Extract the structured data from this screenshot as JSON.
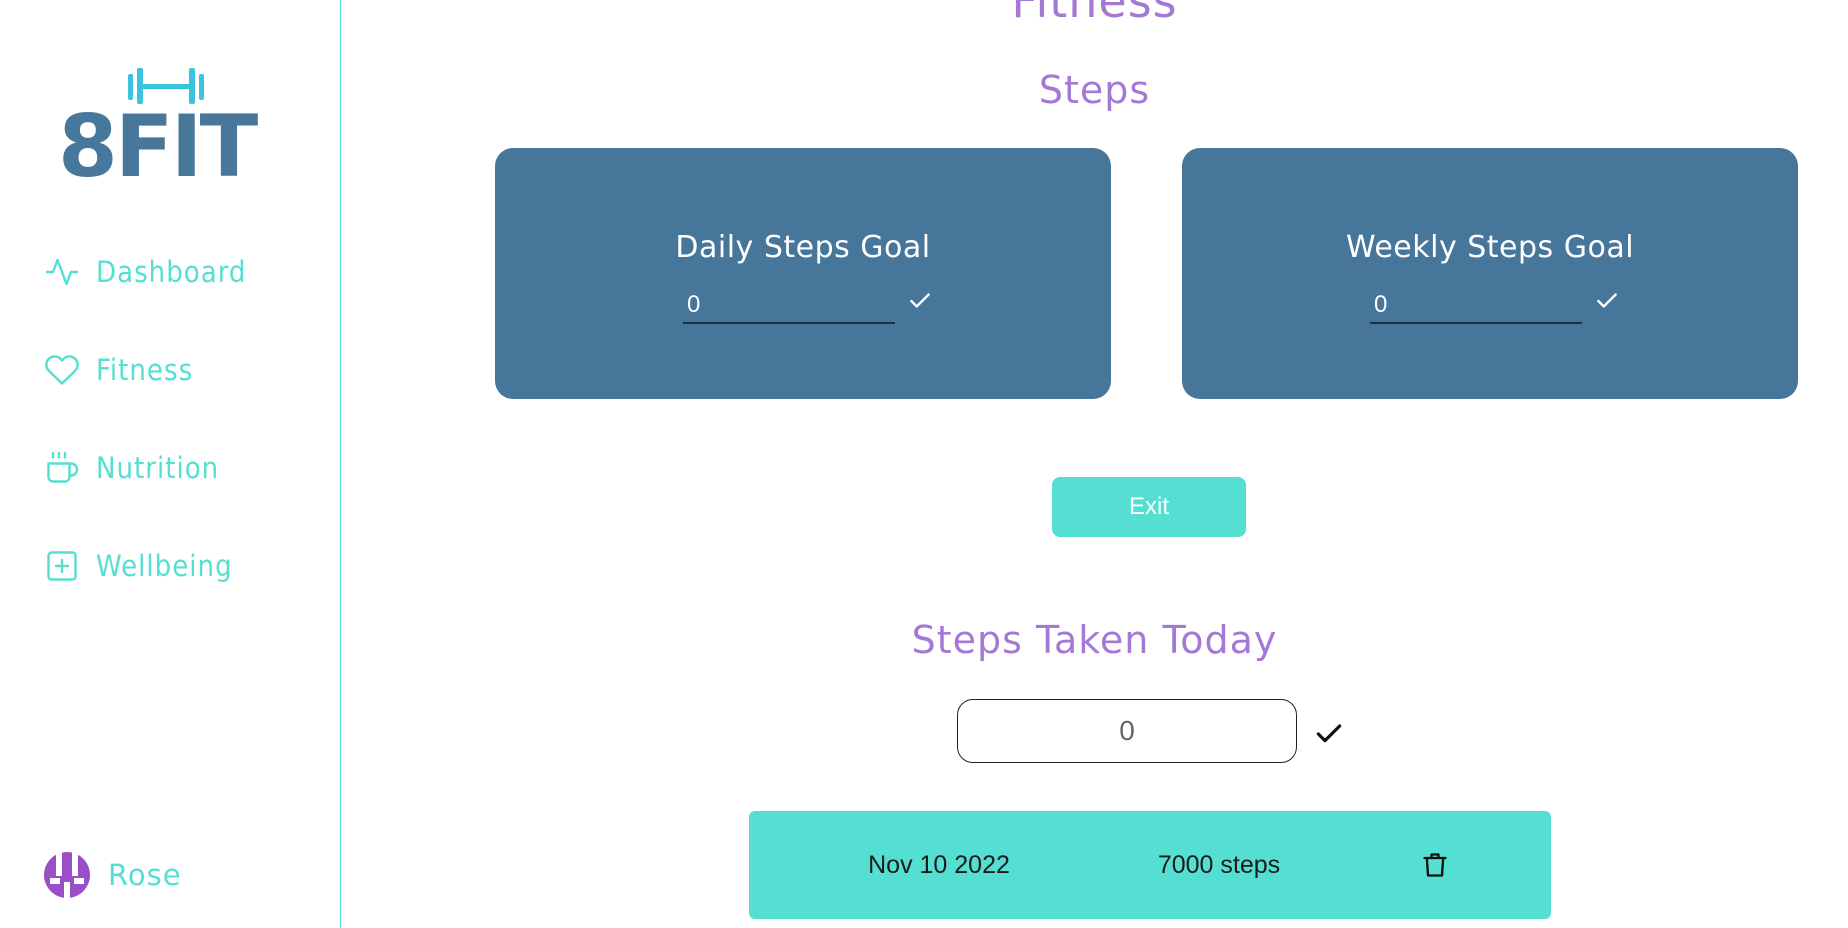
{
  "brand": {
    "logo_text": "8FIT",
    "logo_color": "#47779b",
    "accent_color": "#55dfd2",
    "heading_color": "#a479d6",
    "card_color": "#47769b"
  },
  "sidebar": {
    "items": [
      {
        "label": "Dashboard",
        "icon": "activity-icon"
      },
      {
        "label": "Fitness",
        "icon": "heart-icon"
      },
      {
        "label": "Nutrition",
        "icon": "coffee-cup-icon"
      },
      {
        "label": "Wellbeing",
        "icon": "plus-square-icon"
      }
    ],
    "user": {
      "name": "Rose",
      "icon": "avatar-icon"
    }
  },
  "main": {
    "page_title": "Fitness",
    "steps_section_title": "Steps",
    "daily_goal": {
      "title": "Daily Steps Goal",
      "value": "0"
    },
    "weekly_goal": {
      "title": "Weekly Steps Goal",
      "value": "0"
    },
    "exit_label": "Exit",
    "today_section_title": "Steps Taken Today",
    "today_input_value": "0",
    "log": [
      {
        "date": "Nov 10 2022",
        "steps": "7000 steps"
      }
    ]
  }
}
